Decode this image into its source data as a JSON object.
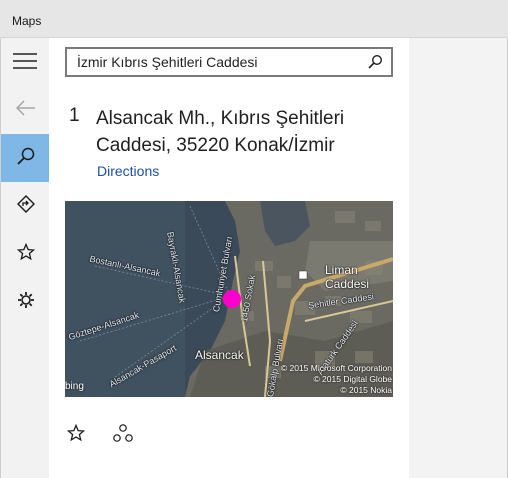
{
  "window": {
    "title": "Maps"
  },
  "sidebar": {
    "items": [
      {
        "name": "menu",
        "icon": "hamburger-menu-icon"
      },
      {
        "name": "back",
        "icon": "back-arrow-icon"
      },
      {
        "name": "search",
        "icon": "search-icon",
        "active": true
      },
      {
        "name": "directions",
        "icon": "directions-icon"
      },
      {
        "name": "favorites",
        "icon": "star-icon"
      },
      {
        "name": "settings",
        "icon": "gear-icon"
      }
    ]
  },
  "search": {
    "value": "İzmir Kıbrıs Şehitleri Caddesi"
  },
  "result": {
    "index": "1",
    "address": "Alsancak Mh., Kıbrıs Şehitleri Caddesi, 35220 Konak/İzmir",
    "directions_label": "Directions"
  },
  "map": {
    "labels": {
      "bayrakli": "Bayraklı-Alsancak",
      "bostanli": "Bostanlı-Alsancak",
      "goztepe": "Göztepe-Alsancak",
      "pasaport": "Alsancak-Pasaport",
      "cumhuriyet": "Cumhuriyet Bulvarı",
      "sokak": "1450 Sokak",
      "liman": "Liman Caddesi",
      "sehitler": "Şehitler Caddesi",
      "ataturk": "Atatürk Caddesi",
      "gokalp": "Gökalp Bulvarı",
      "alsancak": "Alsancak"
    },
    "copyright": [
      "© 2015 Microsoft Corporation",
      "© 2015 Digital Globe",
      "© 2015 Nokia"
    ],
    "provider": "bing",
    "pin_color": "#ff00cc"
  },
  "actions": [
    {
      "name": "favorite",
      "icon": "star-icon"
    },
    {
      "name": "share",
      "icon": "share-icon"
    }
  ]
}
